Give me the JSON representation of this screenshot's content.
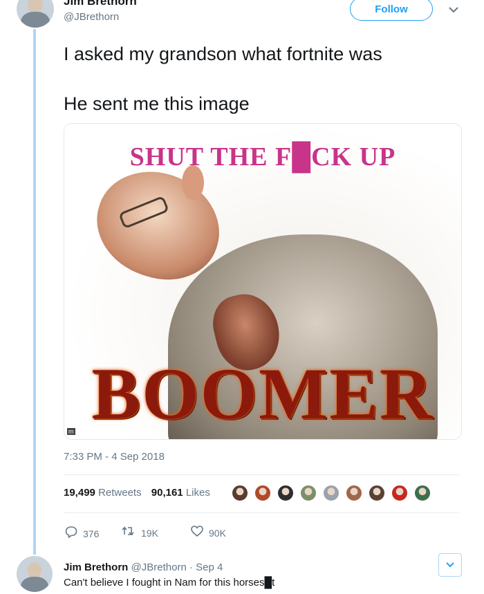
{
  "header": {
    "display_name": "Jim Brethorn",
    "handle": "@JBrethorn",
    "follow_label": "Follow",
    "caret_icon": "chevron-down-icon"
  },
  "tweet": {
    "line1": "I asked my grandson what fortnite was",
    "line2": "He sent me this image",
    "media": {
      "top_text": "SHUT THE F█CK UP",
      "bottom_text": "BOOMER",
      "watermark": "m"
    },
    "timestamp": "7:33 PM - 4 Sep 2018",
    "retweets_count": "19,499",
    "retweets_label": "Retweets",
    "likes_count": "90,161",
    "likes_label": "Likes",
    "liker_colors": [
      "#5a3b2e",
      "#b04a2a",
      "#2e2e2e",
      "#7d8f6a",
      "#9aa3ad",
      "#a0674a",
      "#5b4133",
      "#c8281e",
      "#3d6f4a"
    ],
    "actions": {
      "reply_count": "376",
      "retweet_count": "19K",
      "like_count": "90K"
    }
  },
  "reply": {
    "name": "Jim Brethorn",
    "handle": "@JBrethorn",
    "date": "· Sep 4",
    "text": "Can't believe I fought in Nam for this horses█t"
  },
  "colors": {
    "accent": "#1da1f2",
    "thread_line": "#aed5f5",
    "secondary_text": "#657786"
  }
}
